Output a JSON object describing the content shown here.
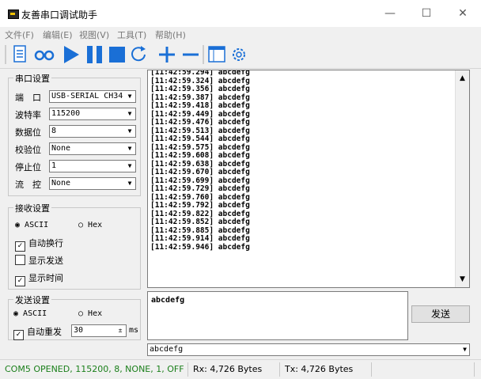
{
  "window": {
    "title": "友善串口调试助手",
    "minimize": "—",
    "maximize": "☐",
    "close": "✕"
  },
  "menu": [
    "文件(F)",
    "编辑(E)",
    "视图(V)",
    "工具(T)",
    "帮助(H)"
  ],
  "serial_settings": {
    "title": "串口设置",
    "port_label": "端　口",
    "port_value": "USB-SERIAL CH34",
    "baud_label": "波特率",
    "baud_value": "115200",
    "databits_label": "数据位",
    "databits_value": "8",
    "parity_label": "校验位",
    "parity_value": "None",
    "stopbits_label": "停止位",
    "stopbits_value": "1",
    "flow_label": "流　控",
    "flow_value": "None"
  },
  "receive_settings": {
    "title": "接收设置",
    "ascii": "ASCII",
    "hex": "Hex",
    "auto_newline": "自动换行",
    "show_send": "显示发送",
    "show_time": "显示时间"
  },
  "send_settings": {
    "title": "发送设置",
    "ascii": "ASCII",
    "hex": "Hex",
    "auto_resend": "自动重发",
    "interval": "30",
    "unit": "ms"
  },
  "receive_log": [
    "[11:42:59.294] abcdefg",
    "[11:42:59.324] abcdefg",
    "[11:42:59.356] abcdefg",
    "[11:42:59.387] abcdefg",
    "[11:42:59.418] abcdefg",
    "[11:42:59.449] abcdefg",
    "[11:42:59.476] abcdefg",
    "[11:42:59.513] abcdefg",
    "[11:42:59.544] abcdefg",
    "[11:42:59.575] abcdefg",
    "[11:42:59.608] abcdefg",
    "[11:42:59.638] abcdefg",
    "[11:42:59.670] abcdefg",
    "[11:42:59.699] abcdefg",
    "[11:42:59.729] abcdefg",
    "[11:42:59.760] abcdefg",
    "[11:42:59.792] abcdefg",
    "[11:42:59.822] abcdefg",
    "[11:42:59.852] abcdefg",
    "[11:42:59.885] abcdefg",
    "[11:42:59.914] abcdefg",
    "[11:42:59.946] abcdefg"
  ],
  "send_text": "abcdefg",
  "send_button": "发送",
  "history_value": "abcdefg",
  "status": {
    "port_state": "COM5 OPENED, 115200, 8, NONE, 1, OFF",
    "rx": "Rx: 4,726 Bytes",
    "tx": "Tx: 4,726 Bytes"
  },
  "colors": {
    "status_green": "#1a7f1a",
    "toolbar_blue": "#1a6fd6"
  }
}
